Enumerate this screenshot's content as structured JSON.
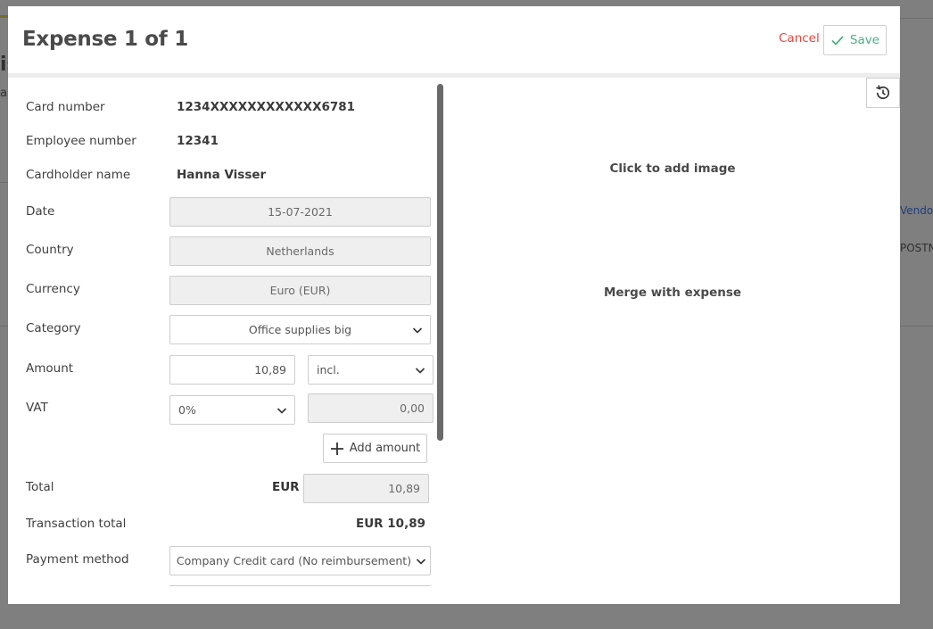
{
  "background": {
    "title_fragment": "is",
    "subtitle_fragment": "a",
    "vendor_fragment": "Vendor",
    "postn_fragment": "POSTN"
  },
  "modal": {
    "title": "Expense 1 of 1",
    "cancel_label": "Cancel",
    "save_label": "Save",
    "colors": {
      "cancel": "#e8453c",
      "save": "#4caf82"
    }
  },
  "form": {
    "card_number": {
      "label": "Card number",
      "value": "1234XXXXXXXXXXXX6781"
    },
    "employee_number": {
      "label": "Employee number",
      "value": "12341"
    },
    "cardholder_name": {
      "label": "Cardholder name",
      "value": "Hanna Visser"
    },
    "date": {
      "label": "Date",
      "value": "15-07-2021"
    },
    "country": {
      "label": "Country",
      "value": "Netherlands"
    },
    "currency": {
      "label": "Currency",
      "value": "Euro (EUR)"
    },
    "category": {
      "label": "Category",
      "value": "Office supplies big"
    },
    "amount": {
      "label": "Amount",
      "value": "10,89",
      "tax_mode": "incl."
    },
    "vat": {
      "label": "VAT",
      "rate": "0%",
      "value": "0,00"
    },
    "add_amount_label": "Add amount",
    "total": {
      "label": "Total",
      "currency": "EUR",
      "value": "10,89"
    },
    "transaction_total": {
      "label": "Transaction total",
      "value": "EUR 10,89"
    },
    "payment_method": {
      "label": "Payment method",
      "value": "Company Credit card (No reimbursement)"
    }
  },
  "image_pane": {
    "click_to_add": "Click to add image",
    "merge": "Merge with expense"
  }
}
